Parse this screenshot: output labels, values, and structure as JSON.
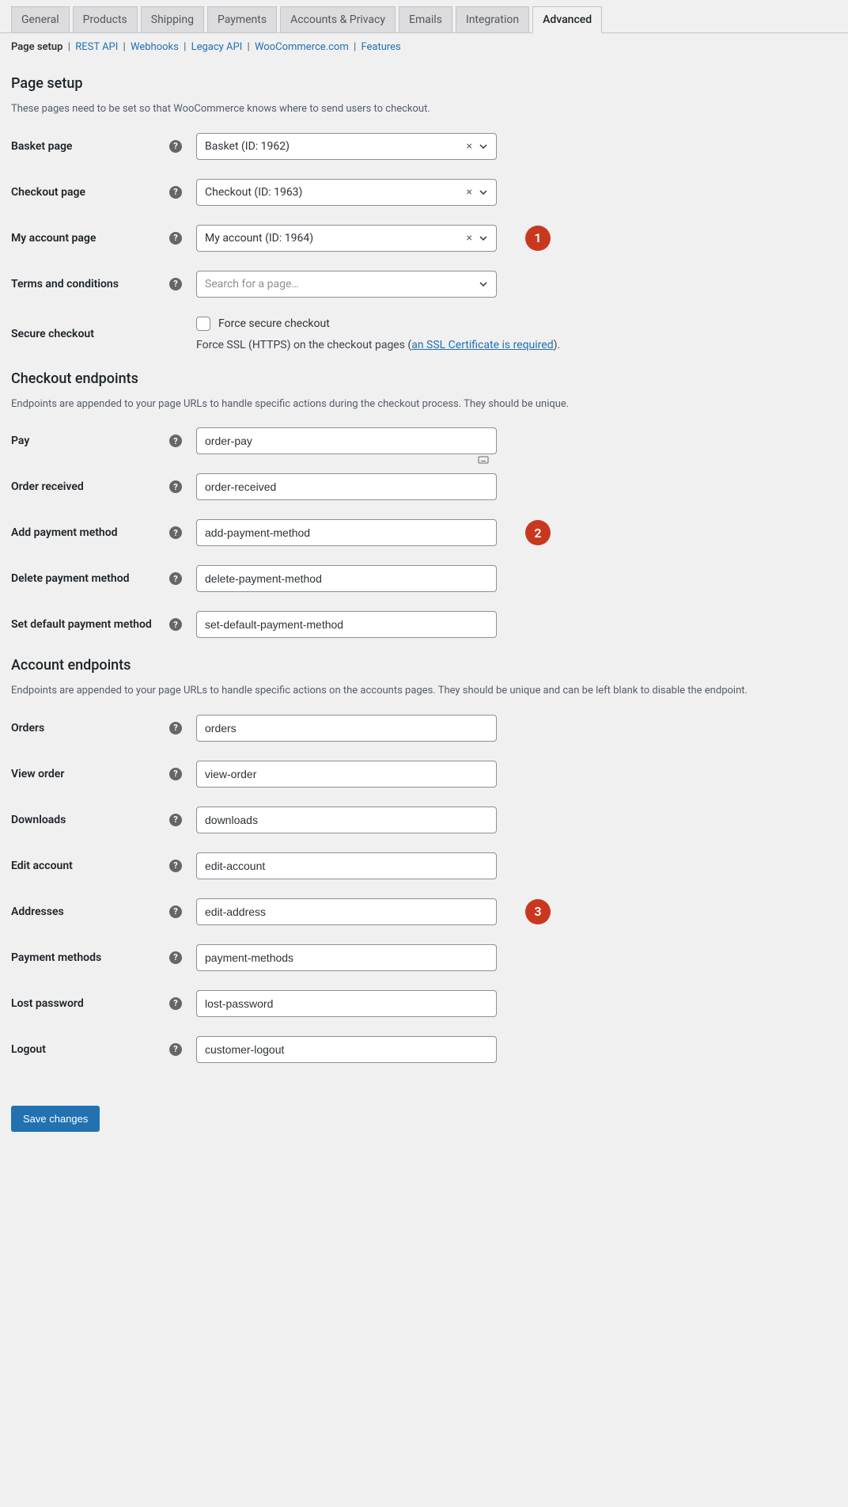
{
  "tabs": [
    "General",
    "Products",
    "Shipping",
    "Payments",
    "Accounts & Privacy",
    "Emails",
    "Integration",
    "Advanced"
  ],
  "activeTab": "Advanced",
  "subnav": {
    "current": "Page setup",
    "links": [
      "REST API",
      "Webhooks",
      "Legacy API",
      "WooCommerce.com",
      "Features"
    ]
  },
  "section1": {
    "title": "Page setup",
    "desc": "These pages need to be set so that WooCommerce knows where to send users to checkout.",
    "rows": [
      {
        "label": "Basket page",
        "value": "Basket (ID: 1962)",
        "type": "select"
      },
      {
        "label": "Checkout page",
        "value": "Checkout (ID: 1963)",
        "type": "select"
      },
      {
        "label": "My account page",
        "value": "My account (ID: 1964)",
        "type": "select",
        "badge": "1"
      },
      {
        "label": "Terms and conditions",
        "placeholder": "Search for a page…",
        "type": "select-empty"
      }
    ],
    "secure": {
      "label": "Secure checkout",
      "cbLabel": "Force secure checkout",
      "descPrefix": "Force SSL (HTTPS) on the checkout pages (",
      "linkText": "an SSL Certificate is required",
      "descSuffix": ")."
    }
  },
  "section2": {
    "title": "Checkout endpoints",
    "desc": "Endpoints are appended to your page URLs to handle specific actions during the checkout process. They should be unique.",
    "rows": [
      {
        "label": "Pay",
        "value": "order-pay",
        "icon": true
      },
      {
        "label": "Order received",
        "value": "order-received"
      },
      {
        "label": "Add payment method",
        "value": "add-payment-method",
        "badge": "2"
      },
      {
        "label": "Delete payment method",
        "value": "delete-payment-method"
      },
      {
        "label": "Set default payment method",
        "value": "set-default-payment-method"
      }
    ]
  },
  "section3": {
    "title": "Account endpoints",
    "desc": "Endpoints are appended to your page URLs to handle specific actions on the accounts pages. They should be unique and can be left blank to disable the endpoint.",
    "rows": [
      {
        "label": "Orders",
        "value": "orders"
      },
      {
        "label": "View order",
        "value": "view-order"
      },
      {
        "label": "Downloads",
        "value": "downloads"
      },
      {
        "label": "Edit account",
        "value": "edit-account"
      },
      {
        "label": "Addresses",
        "value": "edit-address",
        "badge": "3"
      },
      {
        "label": "Payment methods",
        "value": "payment-methods"
      },
      {
        "label": "Lost password",
        "value": "lost-password"
      },
      {
        "label": "Logout",
        "value": "customer-logout"
      }
    ]
  },
  "saveLabel": "Save changes"
}
